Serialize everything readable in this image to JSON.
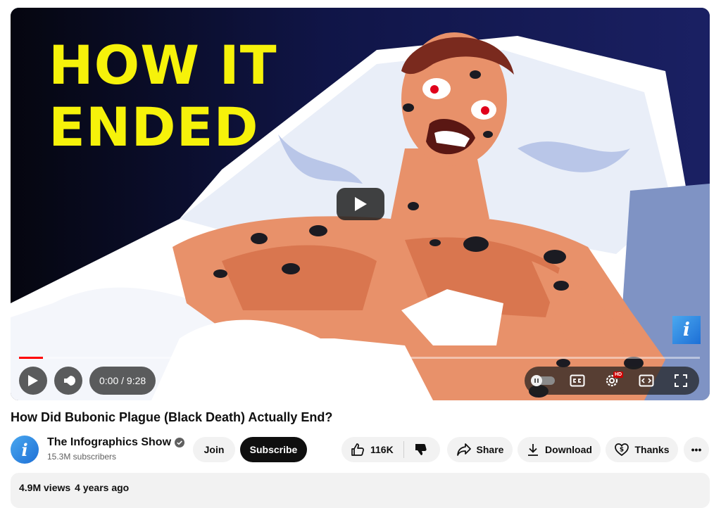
{
  "video": {
    "thumbnail_text_line1": "HOW IT",
    "thumbnail_text_line2": "ENDED",
    "watermark_icon": "infographics-i-icon",
    "progress_fraction": 0.0
  },
  "controls": {
    "current_time": "0:00",
    "separator": " / ",
    "duration": "9:28",
    "icons": [
      "play-icon",
      "volume-icon",
      "autoplay-toggle-icon",
      "cc-icon",
      "settings-icon",
      "miniplayer-icon",
      "fullscreen-icon"
    ],
    "settings_badge": "HD"
  },
  "title": "How Did Bubonic Plague (Black Death) Actually End?",
  "channel": {
    "avatar_letter": "i",
    "name": "The Infographics Show",
    "subscribers": "15.3M subscribers",
    "join_label": "Join",
    "subscribe_label": "Subscribe"
  },
  "actions": {
    "like_count": "116K",
    "share_label": "Share",
    "download_label": "Download",
    "thanks_label": "Thanks",
    "more_label": "•••"
  },
  "description": {
    "views": "4.9M views",
    "age": "4 years ago"
  },
  "colors": {
    "accent_yellow": "#f6f20a",
    "progress_red": "#ff0000",
    "subscribe_bg": "#0f0f0f",
    "chip_bg": "#f2f2f2"
  }
}
